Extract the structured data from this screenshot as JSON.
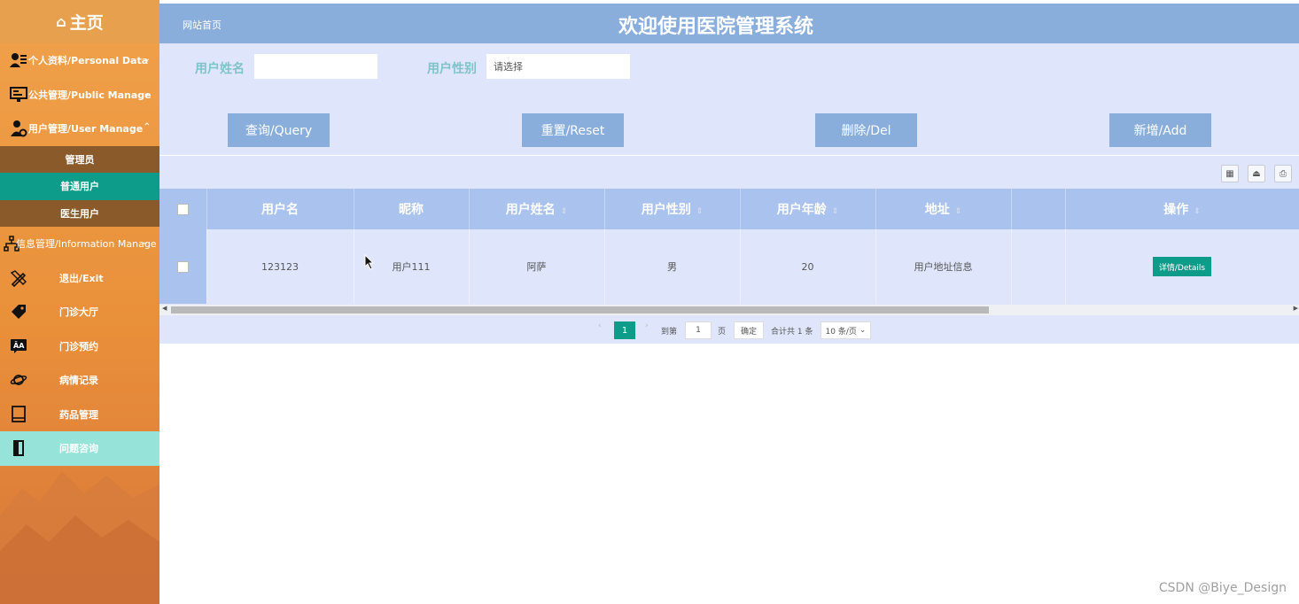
{
  "sidebar": {
    "home_label": "主页",
    "menus": [
      {
        "label": "个人资料/Personal Data",
        "icon": "user-card-icon",
        "chevron": "⌄"
      },
      {
        "label": "公共管理/Public Manage",
        "icon": "monitor-icon",
        "chevron": "⌄"
      },
      {
        "label": "用户管理/User Manage",
        "icon": "user-gear-icon",
        "chevron": "⌃"
      }
    ],
    "submenu": [
      {
        "label": "管理员"
      },
      {
        "label": "普通用户"
      },
      {
        "label": "医生用户"
      }
    ],
    "info_menu": {
      "label": "信息管理/Information Manage",
      "chevron": "⌄"
    },
    "plain_items": [
      {
        "label": "退出/Exit",
        "icon": "pencil-ruler-icon"
      },
      {
        "label": "门诊大厅",
        "icon": "tag-icon"
      },
      {
        "label": "门诊预约",
        "icon": "translate-icon"
      },
      {
        "label": "病情记录",
        "icon": "planet-icon"
      },
      {
        "label": "药品管理",
        "icon": "book-icon"
      },
      {
        "label": "问题咨询",
        "icon": "door-icon"
      }
    ]
  },
  "header": {
    "breadcrumb": "网站首页",
    "title": "欢迎使用医院管理系统"
  },
  "search": {
    "name_label": "用户姓名",
    "name_value": "",
    "gender_label": "用户性别",
    "gender_placeholder": "请选择",
    "buttons": {
      "query": "查询/Query",
      "reset": "重置/Reset",
      "delete": "删除/Del",
      "add": "新增/Add"
    }
  },
  "table": {
    "columns": [
      "用户名",
      "昵称",
      "用户姓名",
      "用户性别",
      "用户年龄",
      "地址",
      "",
      "操作"
    ],
    "rows": [
      {
        "username": "123123",
        "nickname": "用户111",
        "name": "阿萨",
        "gender": "男",
        "age": "20",
        "address": "用户地址信息",
        "extra": "",
        "action": "详情/Details"
      }
    ]
  },
  "pager": {
    "current_page": "1",
    "goto_label": "到第",
    "goto_value": "1",
    "page_unit": "页",
    "confirm": "确定",
    "total": "合计共 1 条",
    "page_size": "10 条/页"
  },
  "watermark": "CSDN @Biye_Design",
  "colors": {
    "sidebar": "#e98f3a",
    "header": "#89aedb",
    "accent": "#0e9c8a",
    "panel": "#dfe6fc",
    "label": "#7fc3c8"
  }
}
